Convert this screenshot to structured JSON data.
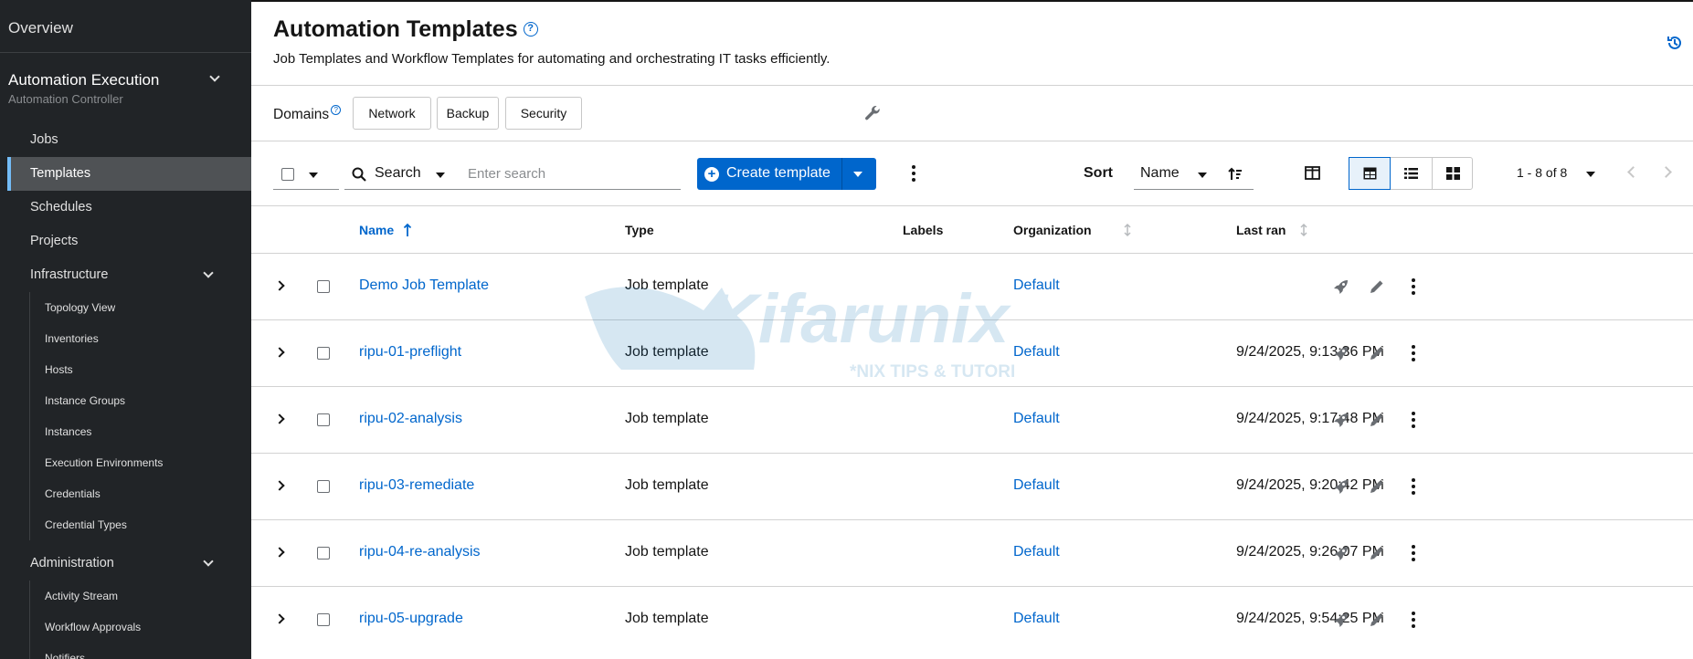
{
  "sidebar": {
    "overview": "Overview",
    "section": {
      "title": "Automation Execution",
      "subtitle": "Automation Controller"
    },
    "items": [
      "Jobs",
      "Templates",
      "Schedules",
      "Projects",
      "Infrastructure"
    ],
    "infrastructure_items": [
      "Topology View",
      "Inventories",
      "Hosts",
      "Instance Groups",
      "Instances",
      "Execution Environments",
      "Credentials",
      "Credential Types"
    ],
    "administration": "Administration",
    "administration_items": [
      "Activity Stream",
      "Workflow Approvals",
      "Notifiers"
    ]
  },
  "header": {
    "title": "Automation Templates",
    "description": "Job Templates and Workflow Templates for automating and orchestrating IT tasks efficiently."
  },
  "domains": {
    "label": "Domains",
    "chips": [
      "Network",
      "Backup",
      "Security"
    ]
  },
  "toolbar": {
    "search_label": "Search",
    "search_placeholder": "Enter search",
    "create_label": "Create template",
    "sort_label": "Sort",
    "sort_value": "Name",
    "pagination": "1 - 8 of 8"
  },
  "table": {
    "columns": [
      "Name",
      "Type",
      "Labels",
      "Organization",
      "Last ran"
    ],
    "rows": [
      {
        "name": "Demo Job Template",
        "type": "Job template",
        "organization": "Default",
        "last_ran": ""
      },
      {
        "name": "ripu-01-preflight",
        "type": "Job template",
        "organization": "Default",
        "last_ran": "9/24/2025, 9:13:36 PM"
      },
      {
        "name": "ripu-02-analysis",
        "type": "Job template",
        "organization": "Default",
        "last_ran": "9/24/2025, 9:17:48 PM"
      },
      {
        "name": "ripu-03-remediate",
        "type": "Job template",
        "organization": "Default",
        "last_ran": "9/24/2025, 9:20:42 PM"
      },
      {
        "name": "ripu-04-re-analysis",
        "type": "Job template",
        "organization": "Default",
        "last_ran": "9/24/2025, 9:26:07 PM"
      },
      {
        "name": "ripu-05-upgrade",
        "type": "Job template",
        "organization": "Default",
        "last_ran": "9/24/2025, 9:54:25 PM"
      }
    ]
  },
  "watermark": {
    "brand": "Kifarunix",
    "tagline": "*NIX TIPS & TUTORIALS"
  },
  "colors": {
    "sidebar_bg": "#212427",
    "accent": "#0066cc",
    "active_item_bg": "#4f5255"
  }
}
